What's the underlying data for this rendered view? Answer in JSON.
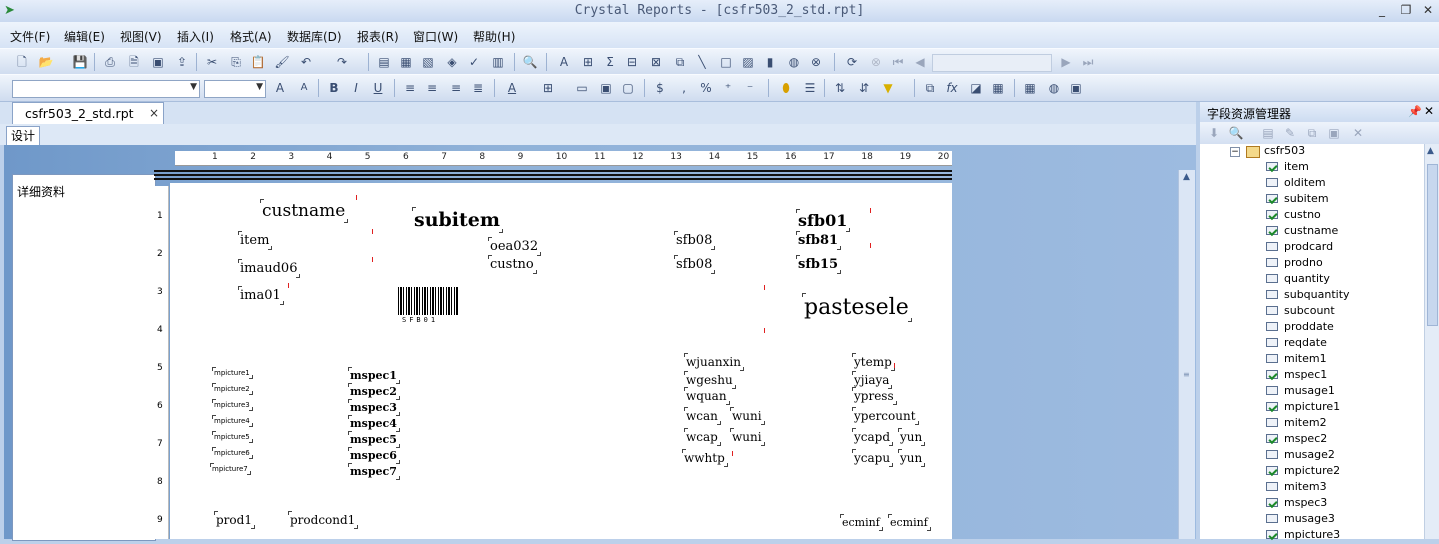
{
  "window": {
    "title": "Crystal Reports - [csfr503_2_std.rpt]",
    "controls": [
      "_",
      "❐",
      "✕"
    ]
  },
  "menu": [
    "文件(F)",
    "编辑(E)",
    "视图(V)",
    "插入(I)",
    "格式(A)",
    "数据库(D)",
    "报表(R)",
    "窗口(W)",
    "帮助(H)"
  ],
  "tabs": {
    "document": "csfr503_2_std.rpt",
    "close": "×",
    "design": "设计"
  },
  "section": {
    "label": "详细资料"
  },
  "ruler": [
    "1",
    "2",
    "3",
    "4",
    "5",
    "6",
    "7",
    "8",
    "9",
    "10",
    "11",
    "12",
    "13",
    "14",
    "15",
    "16",
    "17",
    "18",
    "19",
    "20"
  ],
  "vruler": [
    "1",
    "2",
    "3",
    "4",
    "5",
    "6",
    "7",
    "8",
    "9"
  ],
  "report": {
    "custname": "custname",
    "subitem": "subitem",
    "sfb01": "sfb01",
    "item": "item",
    "oea032": "oea032",
    "sfb08_1": "sfb08",
    "sfb81": "sfb81",
    "imaud06": "imaud06",
    "custno": "custno",
    "sfb08_2": "sfb08",
    "sfb15": "sfb15",
    "ima01": "ima01",
    "barcode_text": "SFB01",
    "pastesele": "pastesele",
    "mpictures": [
      "mpicture1",
      "mpicture2",
      "mpicture3",
      "mpicture4",
      "mpicture5",
      "mpicture6",
      "mpicture7"
    ],
    "mspecs": [
      "mspec1",
      "mspec2",
      "mspec3",
      "mspec4",
      "mspec5",
      "mspec6",
      "mspec7"
    ],
    "wjuanxin": "wjuanxin",
    "wgeshu": "wgeshu",
    "wquan": "wquan",
    "wcan": "wcan",
    "wuni1": "wuni",
    "wcap": "wcap",
    "wuni2": "wuni",
    "wwhtp": "wwhtp",
    "ytemp": "ytemp",
    "yjiaya": "yjiaya",
    "ypress": "ypress",
    "ypercount": "ypercount",
    "ycapd": "ycapd",
    "yun1": "yun",
    "ycapu": "ycapu",
    "yun2": "yun",
    "prod1": "prod1",
    "prodcond1": "prodcond1",
    "ecminf1": "ecminf",
    "ecminf2": "ecminf"
  },
  "explorer": {
    "title": "字段资源管理器",
    "root": "csfr503",
    "fields": [
      {
        "name": "item",
        "used": true
      },
      {
        "name": "olditem",
        "used": false
      },
      {
        "name": "subitem",
        "used": true
      },
      {
        "name": "custno",
        "used": true
      },
      {
        "name": "custname",
        "used": true
      },
      {
        "name": "prodcard",
        "used": false
      },
      {
        "name": "prodno",
        "used": false
      },
      {
        "name": "quantity",
        "used": false
      },
      {
        "name": "subquantity",
        "used": false
      },
      {
        "name": "subcount",
        "used": false
      },
      {
        "name": "proddate",
        "used": false
      },
      {
        "name": "reqdate",
        "used": false
      },
      {
        "name": "mitem1",
        "used": false
      },
      {
        "name": "mspec1",
        "used": true
      },
      {
        "name": "musage1",
        "used": false
      },
      {
        "name": "mpicture1",
        "used": true
      },
      {
        "name": "mitem2",
        "used": false
      },
      {
        "name": "mspec2",
        "used": true
      },
      {
        "name": "musage2",
        "used": false
      },
      {
        "name": "mpicture2",
        "used": true
      },
      {
        "name": "mitem3",
        "used": false
      },
      {
        "name": "mspec3",
        "used": true
      },
      {
        "name": "musage3",
        "used": false
      },
      {
        "name": "mpicture3",
        "used": true
      }
    ]
  },
  "colors": {
    "accent": "#4a5a78",
    "background": "#bcd0ea"
  }
}
